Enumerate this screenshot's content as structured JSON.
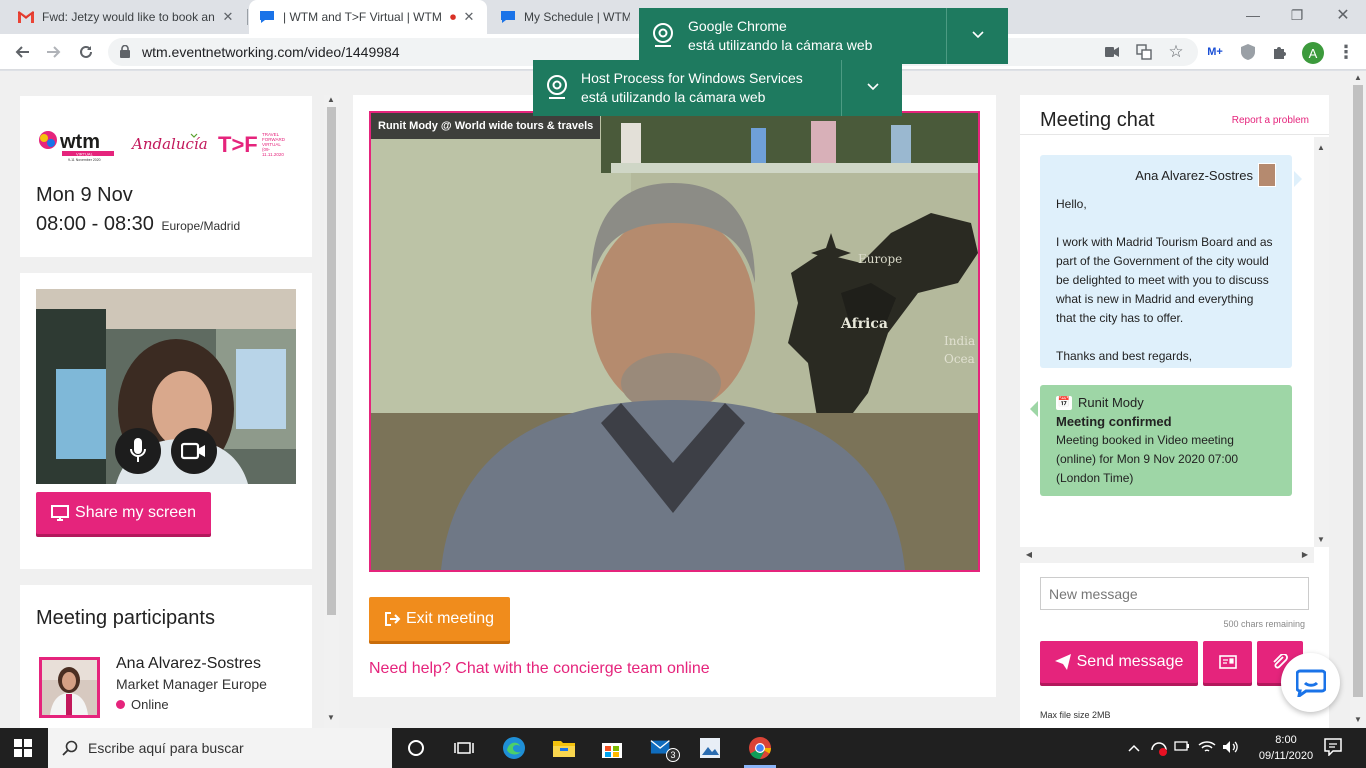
{
  "browser": {
    "tabs": [
      {
        "title": "Fwd: Jetzy would like to book an",
        "icon": "gmail-icon"
      },
      {
        "title": "| WTM and T>F Virtual | WTM",
        "icon": "wtm-icon",
        "recording": true
      },
      {
        "title": "My Schedule | WTM a",
        "icon": "wtm-icon"
      }
    ],
    "url": "wtm.eventnetworking.com/video/1449984"
  },
  "notifications": [
    {
      "line1": "Google Chrome",
      "line2": "está utilizando la cámara web"
    },
    {
      "line1": "Host Process for Windows Services",
      "line2": "está utilizando la cámara web"
    }
  ],
  "event": {
    "logos": {
      "wtm": "wtm",
      "wtm_sub": "VIRTUAL",
      "wtm_dates": "9-11 November 2020",
      "andalucia": "Andalucía",
      "tf": "T>F",
      "tf_sub1": "TRAVEL",
      "tf_sub2": "FORWARD",
      "tf_sub3": "VIRTUAL",
      "tf_sub4": "(09-",
      "tf_sub5": "11.11.2020"
    },
    "date": "Mon 9 Nov",
    "time": "08:00 - 08:30",
    "timezone": "Europe/Madrid"
  },
  "self_video": {
    "share_label": "Share my screen"
  },
  "participants": {
    "title": "Meeting participants",
    "items": [
      {
        "name": "Ana Alvarez-Sostres",
        "role": "Market Manager Europe",
        "status": "Online"
      }
    ]
  },
  "main_video": {
    "caption": "Runit Mody @ World wide tours & travels",
    "map_labels": {
      "europe": "Europe",
      "africa": "Africa",
      "india": "India",
      "ocean": "Ocea"
    }
  },
  "actions": {
    "exit_label": "Exit meeting",
    "help_link": "Need help? Chat with the concierge team online"
  },
  "chat": {
    "title": "Meeting chat",
    "report": "Report a problem",
    "messages": [
      {
        "sender": "Ana Alvarez-Sostres",
        "p1": "Hello,",
        "p2": "I work with Madrid Tourism Board and as part of the Government of the city would be delighted to meet with you to discuss what is new in Madrid and everything that the city has to offer.",
        "p3": "Thanks and best regards,"
      },
      {
        "sender": "Runit Mody",
        "heading": "Meeting confirmed",
        "body": "Meeting booked in Video meeting (online) for Mon 9 Nov 2020 07:00 (London Time)"
      }
    ],
    "input_placeholder": "New message",
    "chars_remaining": "500 chars remaining",
    "send_label": "Send message",
    "max_file": "Max file size 2MB"
  },
  "taskbar": {
    "search_placeholder": "Escribe aquí para buscar",
    "mail_badge": "3",
    "time": "8:00",
    "date": "09/11/2020"
  },
  "colors": {
    "accent": "#e5247c",
    "orange": "#f08c1c",
    "green_bubble": "#9ed6a6",
    "blue_bubble": "#dff0fb",
    "notif": "#1e7a5f"
  }
}
